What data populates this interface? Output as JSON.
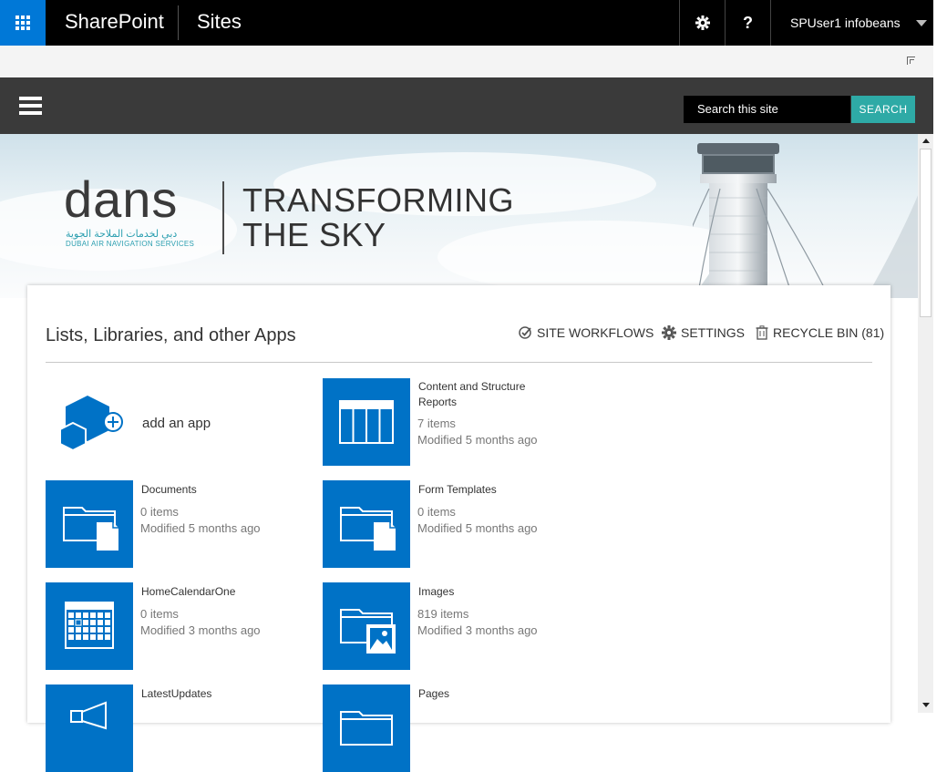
{
  "suite_bar": {
    "brand": "SharePoint",
    "section": "Sites",
    "user": "SPUser1 infobeans",
    "help": "?"
  },
  "nav": {
    "search_placeholder": "Search this site",
    "search_button": "SEARCH"
  },
  "banner": {
    "logo": "dans",
    "logo_arabic": "دبي لخدمات الملاحة الجوية",
    "logo_sub": "DUBAI AIR NAVIGATION SERVICES",
    "tagline_line1": "TRANSFORMING",
    "tagline_line2": "THE SKY"
  },
  "content": {
    "title": "Lists, Libraries, and other Apps",
    "actions": {
      "site_workflows": "SITE WORKFLOWS",
      "settings": "SETTINGS",
      "recycle_bin": "RECYCLE BIN (81)"
    },
    "add_app": "add an app",
    "apps": [
      {
        "name_line1": "Content and Structure",
        "name_line2": "Reports",
        "count": "7 items",
        "modified": "Modified 5 months ago",
        "icon": "table-icon"
      },
      {
        "name_line1": "Documents",
        "name_line2": "",
        "count": "0 items",
        "modified": "Modified 5 months ago",
        "icon": "document-library-icon"
      },
      {
        "name_line1": "Form Templates",
        "name_line2": "",
        "count": "0 items",
        "modified": "Modified 5 months ago",
        "icon": "document-library-icon"
      },
      {
        "name_line1": "HomeCalendarOne",
        "name_line2": "",
        "count": "0 items",
        "modified": "Modified 3 months ago",
        "icon": "calendar-icon"
      },
      {
        "name_line1": "Images",
        "name_line2": "",
        "count": "819 items",
        "modified": "Modified 3 months ago",
        "icon": "picture-library-icon"
      },
      {
        "name_line1": "LatestUpdates",
        "name_line2": "",
        "count": "",
        "modified": "",
        "icon": "announcements-icon"
      },
      {
        "name_line1": "Pages",
        "name_line2": "",
        "count": "",
        "modified": "",
        "icon": "pages-library-icon"
      }
    ]
  },
  "colors": {
    "suite_bar": "#000000",
    "waffle": "#0078d7",
    "nav_bar": "#3a3a3a",
    "search_button": "#2eaaa6",
    "tile": "#0072c6"
  }
}
